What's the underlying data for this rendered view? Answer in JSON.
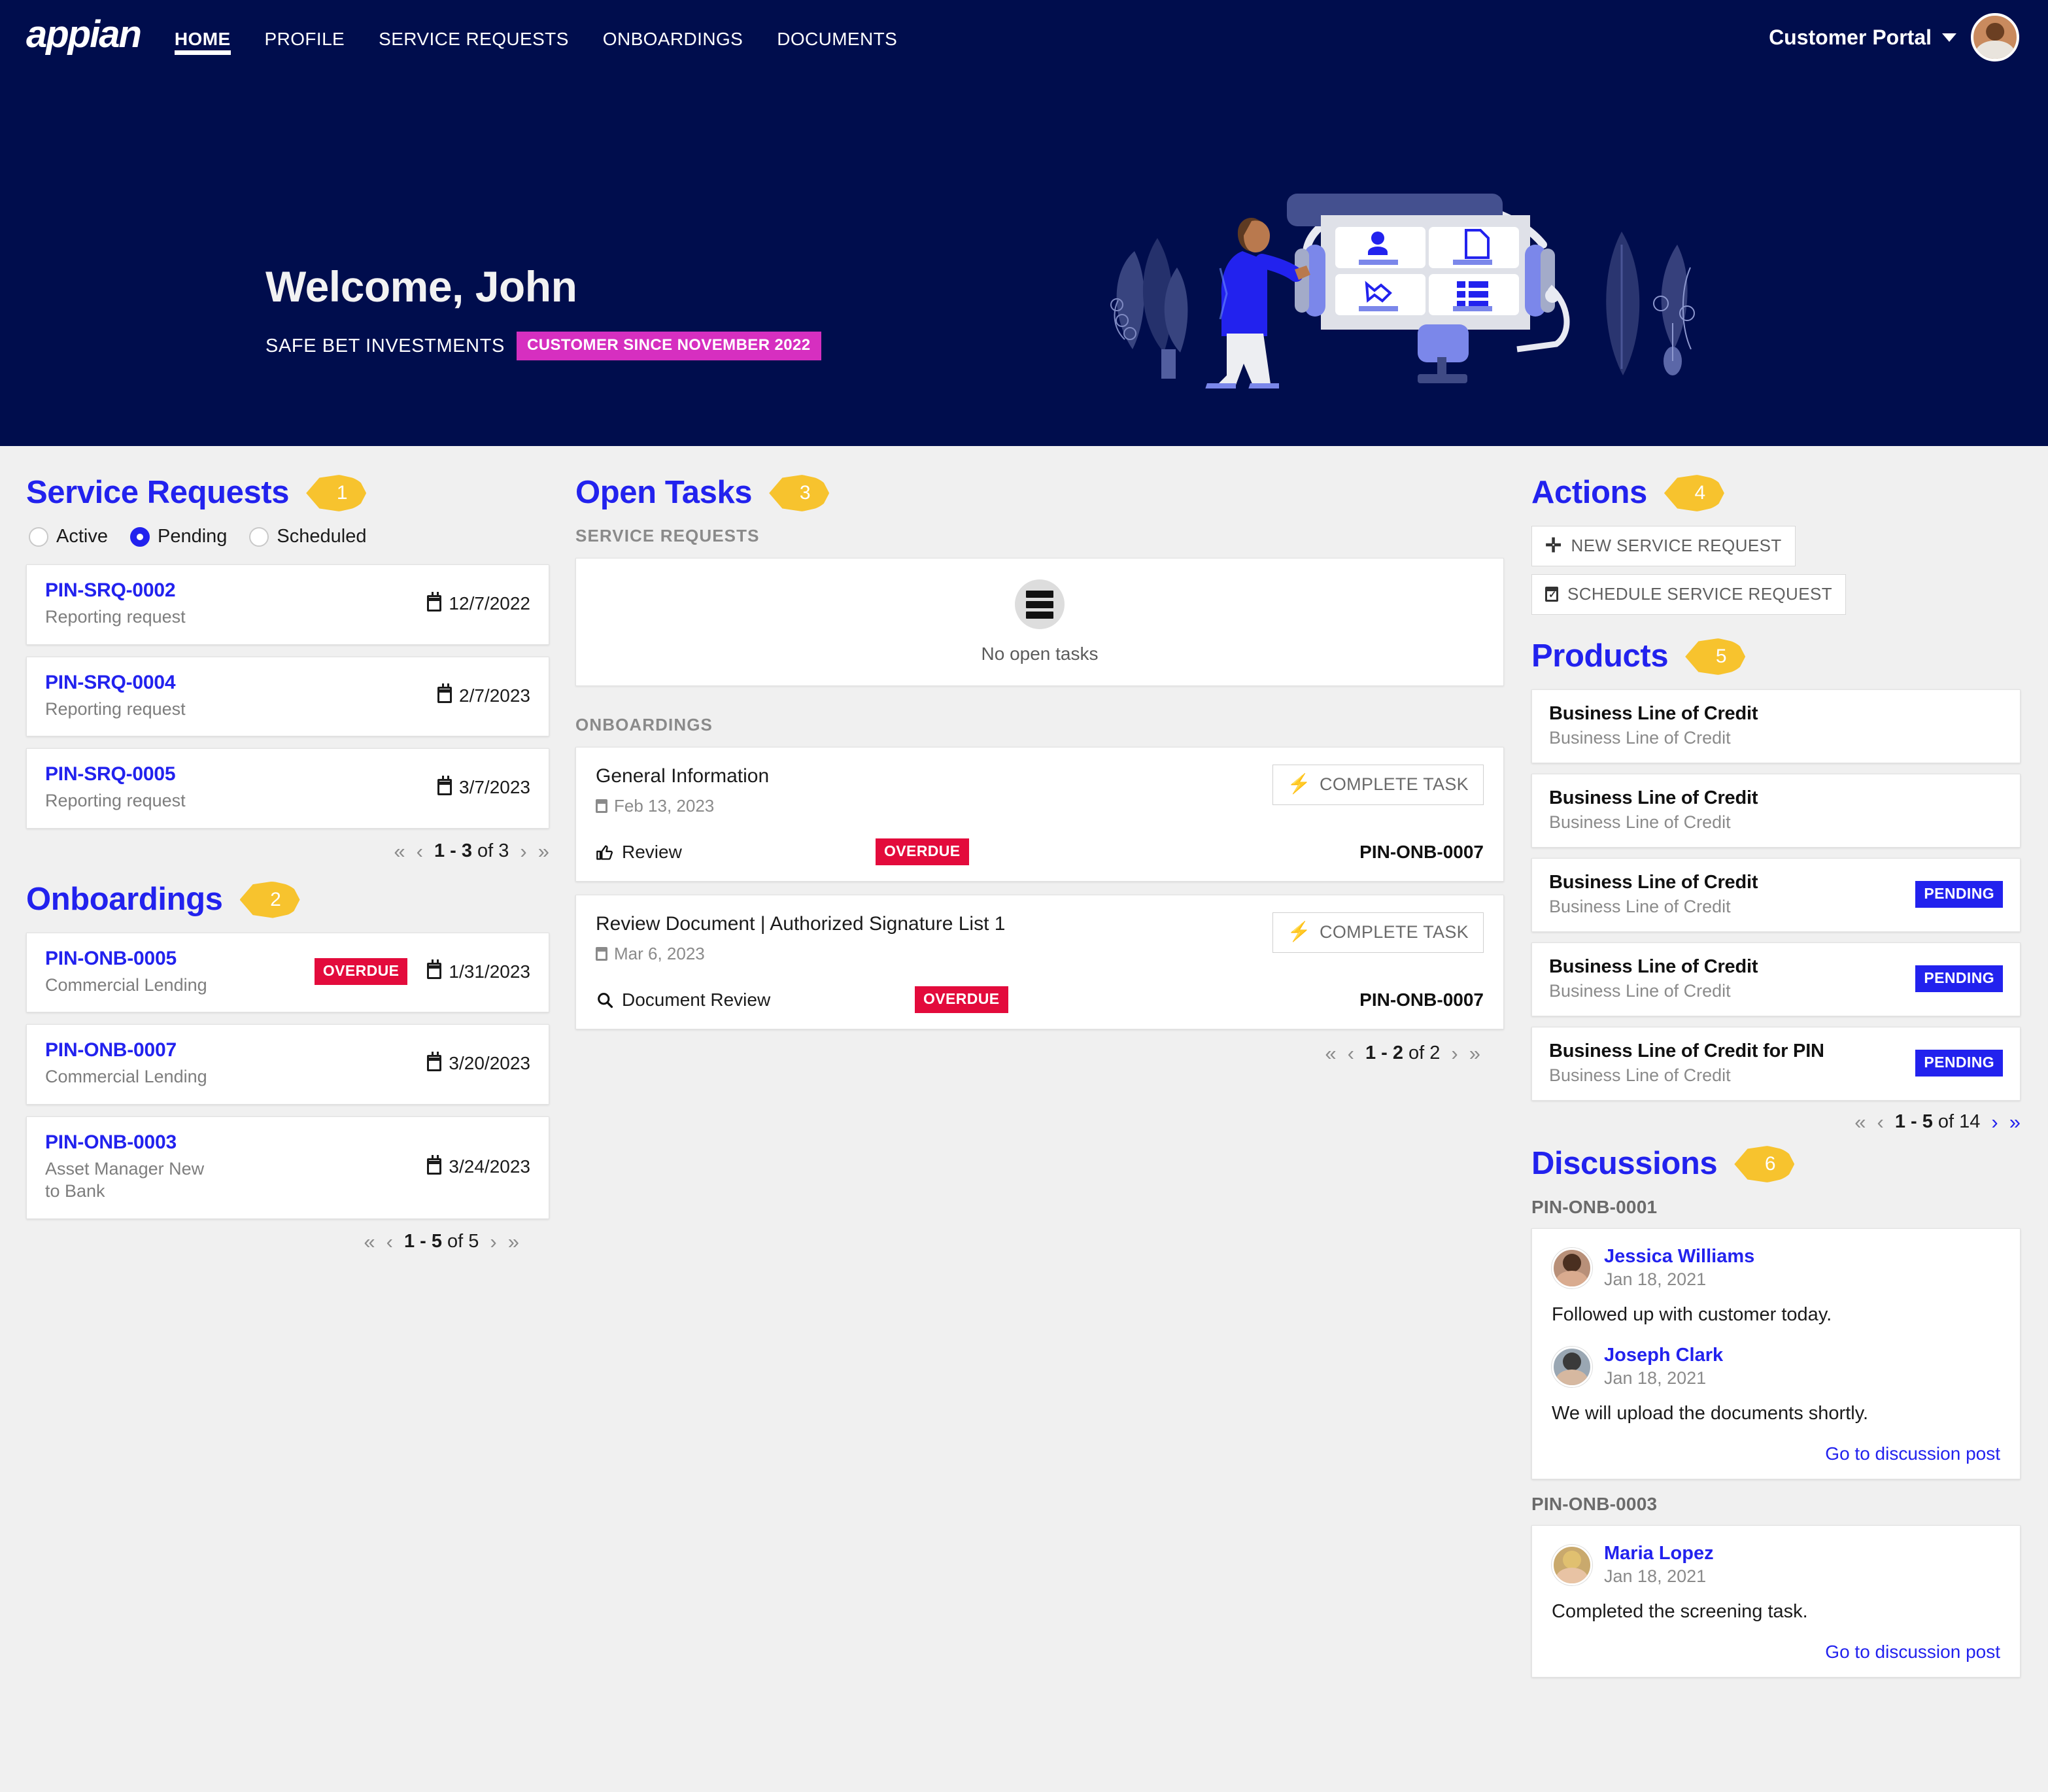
{
  "header": {
    "logo": "appian",
    "nav": [
      {
        "label": "HOME",
        "active": true
      },
      {
        "label": "PROFILE",
        "active": false
      },
      {
        "label": "SERVICE REQUESTS",
        "active": false
      },
      {
        "label": "ONBOARDINGS",
        "active": false
      },
      {
        "label": "DOCUMENTS",
        "active": false
      }
    ],
    "portal_label": "Customer Portal"
  },
  "hero": {
    "title": "Welcome, John",
    "company": "SAFE BET INVESTMENTS",
    "badge": "CUSTOMER SINCE NOVEMBER 2022"
  },
  "service_requests": {
    "title": "Service Requests",
    "callout": "1",
    "filters": [
      {
        "label": "Active",
        "checked": false
      },
      {
        "label": "Pending",
        "checked": true
      },
      {
        "label": "Scheduled",
        "checked": false
      }
    ],
    "items": [
      {
        "id": "PIN-SRQ-0002",
        "type": "Reporting request",
        "date": "12/7/2022",
        "status": ""
      },
      {
        "id": "PIN-SRQ-0004",
        "type": "Reporting request",
        "date": "2/7/2023",
        "status": ""
      },
      {
        "id": "PIN-SRQ-0005",
        "type": "Reporting request",
        "date": "3/7/2023",
        "status": ""
      }
    ],
    "pager": {
      "range": "1 - 3",
      "of": " of 3"
    }
  },
  "onboardings": {
    "title": "Onboardings",
    "callout": "2",
    "items": [
      {
        "id": "PIN-ONB-0005",
        "type": "Commercial Lending",
        "date": "1/31/2023",
        "status": "OVERDUE"
      },
      {
        "id": "PIN-ONB-0007",
        "type": "Commercial Lending",
        "date": "3/20/2023",
        "status": ""
      },
      {
        "id": "PIN-ONB-0003",
        "type": "Asset Manager New to Bank",
        "date": "3/24/2023",
        "status": ""
      }
    ],
    "pager": {
      "range": "1 - 5",
      "of": " of 5"
    }
  },
  "open_tasks": {
    "title": "Open Tasks",
    "callout": "3",
    "service_requests_label": "SERVICE REQUESTS",
    "empty_text": "No open tasks",
    "onboardings_label": "ONBOARDINGS",
    "tasks": [
      {
        "name": "General Information",
        "date": "Feb 13, 2023",
        "button": "COMPLETE TASK",
        "type": "Review",
        "type_icon": "thumbs-up-icon",
        "status": "OVERDUE",
        "ref": "PIN-ONB-0007"
      },
      {
        "name": "Review Document | Authorized Signature List 1",
        "date": "Mar 6, 2023",
        "button": "COMPLETE TASK",
        "type": "Document Review",
        "type_icon": "magnifier-icon",
        "status": "OVERDUE",
        "ref": "PIN-ONB-0007"
      }
    ],
    "pager": {
      "range": "1 - 2",
      "of": " of 2"
    }
  },
  "actions": {
    "title": "Actions",
    "callout": "4",
    "buttons": [
      {
        "label": "NEW SERVICE REQUEST",
        "icon": "plus-icon"
      },
      {
        "label": "SCHEDULE SERVICE REQUEST",
        "icon": "calendar-check-icon"
      }
    ]
  },
  "products": {
    "title": "Products",
    "callout": "5",
    "items": [
      {
        "name": "Business Line of Credit",
        "sub": "Business Line of Credit",
        "status": ""
      },
      {
        "name": "Business Line of Credit",
        "sub": "Business Line of Credit",
        "status": ""
      },
      {
        "name": "Business Line of Credit",
        "sub": "Business Line of Credit",
        "status": "PENDING"
      },
      {
        "name": "Business Line of Credit",
        "sub": "Business Line of Credit",
        "status": "PENDING"
      },
      {
        "name": "Business Line of Credit for PIN",
        "sub": "Business Line of Credit",
        "status": "PENDING"
      }
    ],
    "pager": {
      "range": "1 - 5",
      "of": " of 14"
    }
  },
  "discussions": {
    "title": "Discussions",
    "callout": "6",
    "threads": [
      {
        "ref": "PIN-ONB-0001",
        "posts": [
          {
            "author": "Jessica Williams",
            "date": "Jan 18, 2021",
            "body": "Followed up with customer today."
          },
          {
            "author": "Joseph Clark",
            "date": "Jan 18, 2021",
            "body": "We will upload the documents shortly."
          }
        ],
        "link": "Go to discussion post"
      },
      {
        "ref": "PIN-ONB-0003",
        "posts": [
          {
            "author": "Maria Lopez",
            "date": "Jan 18, 2021",
            "body": "Completed the screening task."
          }
        ],
        "link": "Go to discussion post"
      }
    ]
  },
  "colors": {
    "navy": "#000d4d",
    "accent_blue": "#2222ee",
    "callout_yellow": "#f7c32e",
    "overdue_red": "#e30b3c",
    "magenta": "#d62fc0"
  }
}
